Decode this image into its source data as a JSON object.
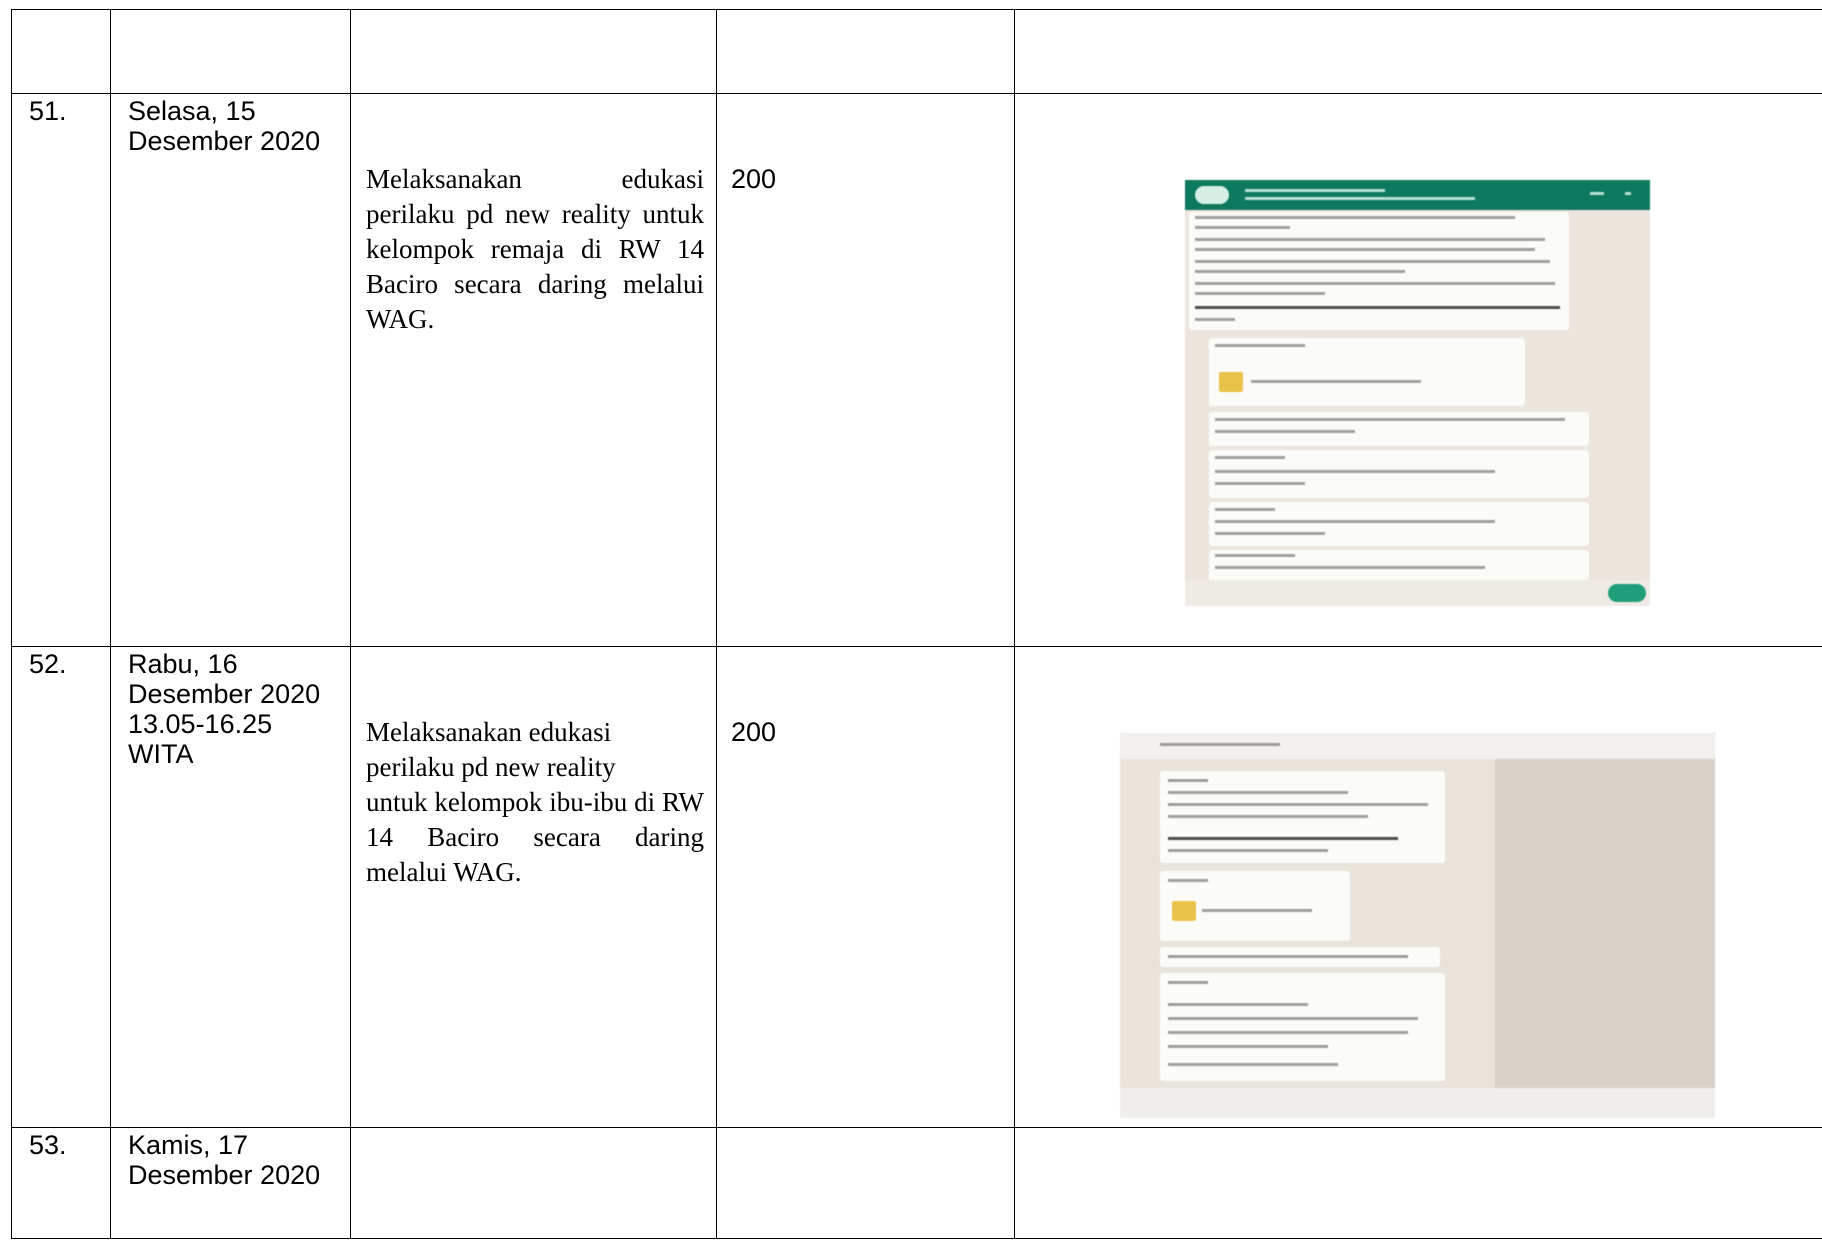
{
  "rows": [
    {
      "number": "",
      "date": [],
      "activity": "",
      "value": ""
    },
    {
      "number": "51.",
      "date": [
        "Selasa, 15",
        "Desember 2020"
      ],
      "activity": "Melaksanakan edukasi perilaku pd new reality untuk kelompok remaja di RW 14 Baciro secara daring melalui WAG.",
      "value": "200",
      "evidence": "whatsapp-group-screenshot"
    },
    {
      "number": "52.",
      "date": [
        "Rabu, 16",
        "Desember 2020",
        "13.05-16.25",
        "WITA"
      ],
      "activity_lines": [
        "Melaksanakan edukasi",
        "perilaku pd new reality",
        "untuk kelompok ibu-ibu di RW 14 Baciro secara daring melalui WAG."
      ],
      "value": "200",
      "evidence": "whatsapp-group-screenshot"
    },
    {
      "number": "53.",
      "date": [
        "Kamis, 17",
        "Desember 2020"
      ],
      "activity": "",
      "value": ""
    }
  ],
  "colors": {
    "border": "#000000",
    "whatsapp_header": "#0d7a5f",
    "chat_background": "#ece5dd"
  }
}
